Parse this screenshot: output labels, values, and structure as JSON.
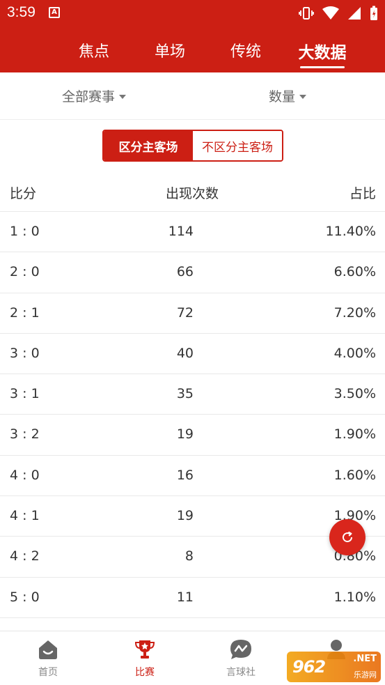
{
  "status": {
    "time": "3:59",
    "notification_letter": "A"
  },
  "top_tabs": [
    {
      "label": "焦点",
      "active": false
    },
    {
      "label": "单场",
      "active": false
    },
    {
      "label": "传统",
      "active": false
    },
    {
      "label": "大数据",
      "active": true
    }
  ],
  "filters": {
    "competition": "全部赛事",
    "sort": "数量"
  },
  "segment": {
    "active": "区分主客场",
    "inactive": "不区分主客场"
  },
  "table": {
    "headers": {
      "score": "比分",
      "count": "出现次数",
      "ratio": "占比"
    },
    "rows": [
      {
        "score": "1 : 0",
        "count": "114",
        "ratio": "11.40%"
      },
      {
        "score": "2 : 0",
        "count": "66",
        "ratio": "6.60%"
      },
      {
        "score": "2 : 1",
        "count": "72",
        "ratio": "7.20%"
      },
      {
        "score": "3 : 0",
        "count": "40",
        "ratio": "4.00%"
      },
      {
        "score": "3 : 1",
        "count": "35",
        "ratio": "3.50%"
      },
      {
        "score": "3 : 2",
        "count": "19",
        "ratio": "1.90%"
      },
      {
        "score": "4 : 0",
        "count": "16",
        "ratio": "1.60%"
      },
      {
        "score": "4 : 1",
        "count": "19",
        "ratio": "1.90%"
      },
      {
        "score": "4 : 2",
        "count": "8",
        "ratio": "0.80%"
      },
      {
        "score": "5 : 0",
        "count": "11",
        "ratio": "1.10%"
      }
    ]
  },
  "bottom_nav": [
    {
      "label": "首页",
      "icon": "home-icon",
      "active": false
    },
    {
      "label": "比赛",
      "icon": "trophy-icon",
      "active": true
    },
    {
      "label": "言球社",
      "icon": "chat-icon",
      "active": false
    },
    {
      "label": "",
      "icon": "profile-icon",
      "active": false
    }
  ],
  "watermark": {
    "main": "962",
    "net": ".NET",
    "sub": "乐游网"
  },
  "colors": {
    "brand_red": "#cc1f14"
  }
}
